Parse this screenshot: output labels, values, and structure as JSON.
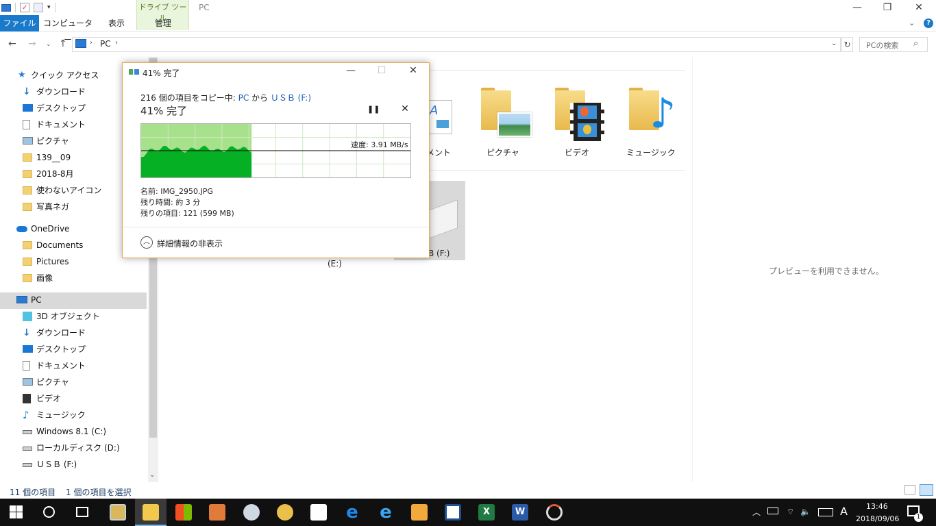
{
  "window": {
    "title": "PC",
    "contextual_tab_group": "ドライブ ツール"
  },
  "ribbon": {
    "tabs": [
      {
        "label": "ファイル"
      },
      {
        "label": "コンピューター"
      },
      {
        "label": "表示"
      },
      {
        "label": "管理"
      }
    ]
  },
  "address": {
    "path": "PC",
    "search_placeholder": "PCの検索"
  },
  "sidebar": {
    "quick_access": "クイック アクセス",
    "quick_items": [
      "ダウンロード",
      "デスクトップ",
      "ドキュメント",
      "ピクチャ",
      "139__09",
      "2018-8月",
      "使わないアイコン",
      "写真ネガ"
    ],
    "onedrive": "OneDrive",
    "onedrive_items": [
      "Documents",
      "Pictures",
      "画像"
    ],
    "pc": "PC",
    "pc_items": [
      "3D オブジェクト",
      "ダウンロード",
      "デスクトップ",
      "ドキュメント",
      "ピクチャ",
      "ビデオ",
      "ミュージック",
      "Windows 8.1 (C:)",
      "ローカルディスク (D:)",
      "ＵＳＢ (F:)"
    ]
  },
  "content": {
    "folders": [
      {
        "label": "メント",
        "icon": "document-folder-icon"
      },
      {
        "label": "ピクチャ",
        "icon": "pictures-folder-icon"
      },
      {
        "label": "ビデオ",
        "icon": "videos-folder-icon"
      },
      {
        "label": "ミュージック",
        "icon": "music-folder-icon"
      }
    ],
    "drive_e_label": "(E:)",
    "drive_usb_label": "B (F:)"
  },
  "preview": {
    "text": "プレビューを利用できません。"
  },
  "status": {
    "count": "11 個の項目",
    "selected": "1 個の項目を選択"
  },
  "copy_dialog": {
    "title": "41% 完了",
    "copying_prefix": "216 個の項目をコピー中: ",
    "source": "PC",
    "from_word": " から ",
    "destination": "ＵＳＢ (F:)",
    "percent_text": "41% 完了",
    "progress": 0.41,
    "speed": "速度: 3.91 MB/s",
    "name_line": "名前:  IMG_2950.JPG",
    "remaining_time": "残り時間:  約 3 分",
    "remaining_items": "残りの項目:  121 (599 MB)",
    "details_toggle": "詳細情報の非表示",
    "colors": {
      "fill": "#06b025",
      "bg_done": "#a8e18c",
      "grid": "#cfe8c4"
    }
  },
  "taskbar": {
    "time": "13:46",
    "date": "2018/09/06",
    "ime": "A",
    "notifications": "1"
  }
}
